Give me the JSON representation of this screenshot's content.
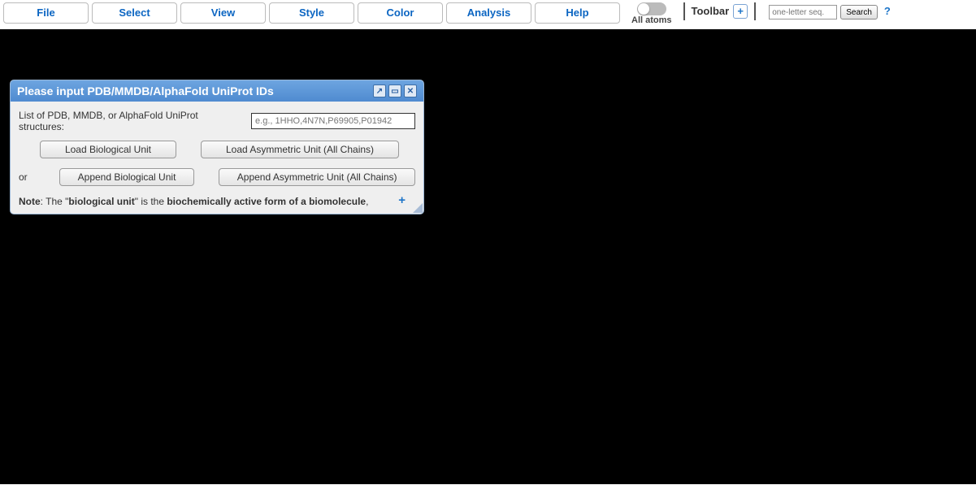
{
  "menu": [
    "File",
    "Select",
    "View",
    "Style",
    "Color",
    "Analysis",
    "Help"
  ],
  "toggle_text": "All atoms",
  "toolbar_label": "Toolbar",
  "seq_placeholder": "one-letter seq.",
  "search_label": "Search",
  "dialog": {
    "title": "Please input PDB/MMDB/AlphaFold UniProt IDs",
    "list_label": "List of PDB, MMDB, or AlphaFold UniProt structures:",
    "id_placeholder": "e.g., 1HHO,4N7N,P69905,P01942",
    "load_bio": "Load Biological Unit",
    "load_asym": "Load Asymmetric Unit (All Chains)",
    "or": "or",
    "append_bio": "Append Biological Unit",
    "append_asym": "Append Asymmetric Unit (All Chains)",
    "note_label": "Note",
    "note_1": ": The \"",
    "note_bold1": "biological unit",
    "note_2": "\" is the ",
    "note_bold2": "biochemically active form of a biomolecule",
    "note_3": ","
  }
}
